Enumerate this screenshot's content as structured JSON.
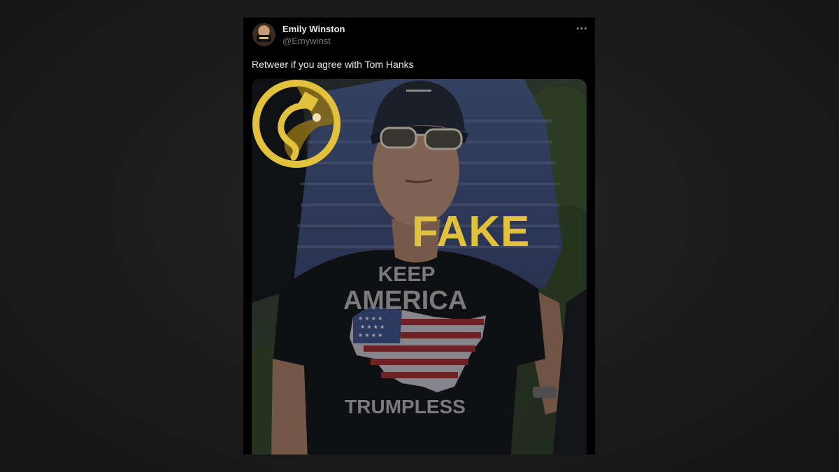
{
  "tweet": {
    "display_name": "Emily Winston",
    "handle": "@Emywinst",
    "text": "Retweer if you agree with Tom Hanks",
    "more_icon": "more-horizontal-icon"
  },
  "media": {
    "overlay_label": "FAKE",
    "overlay_icon": "fact-check-logo-icon",
    "shirt_text": [
      "KEEP",
      "AMERICA",
      "TRUMPLESS"
    ]
  },
  "colors": {
    "background": "#1b1b1b",
    "card": "#000000",
    "name": "#e7e9ea",
    "handle": "#71767b",
    "fake_gold": "#e2c13c"
  }
}
